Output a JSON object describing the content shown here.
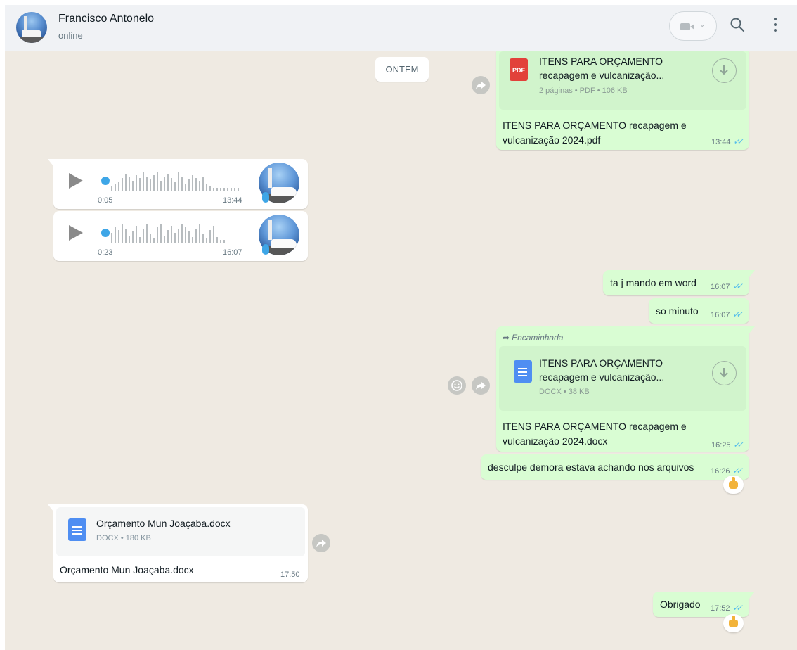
{
  "header": {
    "contact_name": "Francisco Antonelo",
    "contact_status": "online"
  },
  "date_divider": "ONTEM",
  "messages": {
    "pdf_doc": {
      "title_line1": "ITENS PARA ORÇAMENTO",
      "title_line2": "recapagem e vulcanização...",
      "meta": "2 páginas • PDF • 106 KB",
      "icon_label": "PDF",
      "caption_line1": "ITENS PARA ORÇAMENTO recapagem e",
      "caption_line2": "vulcanização 2024.pdf",
      "time": "13:44"
    },
    "voice_1": {
      "duration": "0:05",
      "time": "13:44"
    },
    "voice_2": {
      "duration": "0:23",
      "time": "16:07"
    },
    "text_1": {
      "text": "ta j mando em word",
      "time": "16:07"
    },
    "text_2": {
      "text": "so minuto",
      "time": "16:07"
    },
    "docx_forwarded": {
      "forwarded_label": "Encaminhada",
      "title_line1": "ITENS PARA ORÇAMENTO",
      "title_line2": "recapagem e vulcanização...",
      "meta": "DOCX • 38 KB",
      "caption_line1": "ITENS PARA ORÇAMENTO recapagem e",
      "caption_line2": "vulcanização 2024.docx",
      "time": "16:25"
    },
    "text_3": {
      "text": "desculpe demora estava achando nos arquivos",
      "time": "16:26",
      "reaction": "thumbs-up"
    },
    "docx_incoming": {
      "title": "Orçamento Mun Joaçaba.docx",
      "meta": "DOCX • 180 KB",
      "caption": "Orçamento Mun Joaçaba.docx",
      "time": "17:50"
    },
    "text_4": {
      "text": "Obrigado",
      "time": "17:52",
      "reaction": "thumbs-up"
    }
  },
  "colors": {
    "chat_background": "#efeae2",
    "outgoing_bubble": "#d9fdd3",
    "incoming_bubble": "#ffffff",
    "read_ticks": "#53bdeb",
    "pdf_icon": "#e2413a",
    "word_icon": "#4f8ef2"
  }
}
